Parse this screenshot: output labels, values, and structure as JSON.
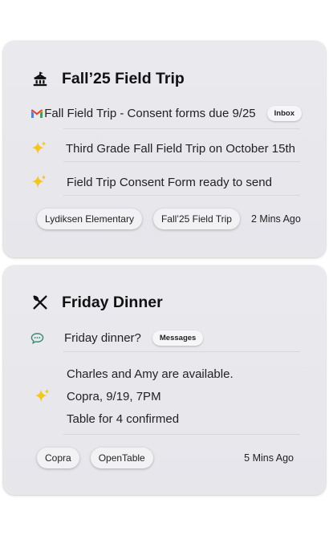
{
  "cards": [
    {
      "title": "Fall’25 Field Trip",
      "title_icon": "school-icon",
      "rows": [
        {
          "icon": "gmail-icon",
          "text": "Fall Field Trip - Consent forms due 9/25",
          "badge": "Inbox"
        },
        {
          "icon": "sparkle-icon",
          "text": "Third Grade Fall Field Trip on October 15th"
        },
        {
          "icon": "sparkle-icon",
          "text": "Field Trip Consent Form ready to send"
        }
      ],
      "chips": [
        "Lydiksen Elementary",
        "Fall’25 Field Trip"
      ],
      "time": "2 Mins Ago"
    },
    {
      "title": "Friday Dinner",
      "title_icon": "restaurant-icon",
      "rows": [
        {
          "icon": "chat-icon",
          "text": "Friday dinner?",
          "badge": "Messages"
        }
      ],
      "summary_lines": [
        "Charles and Amy are available.",
        "Copra, 9/19, 7PM",
        "Table for 4 confirmed"
      ],
      "chips": [
        "Copra",
        "OpenTable"
      ],
      "time": "5 Mins Ago"
    }
  ],
  "colors": {
    "sparkle": "#f5c518",
    "chat": "#3b8a6e",
    "gmail_red": "#ea4335",
    "gmail_blue": "#4285f4",
    "gmail_green": "#34a853",
    "gmail_yellow": "#fbbc05"
  }
}
